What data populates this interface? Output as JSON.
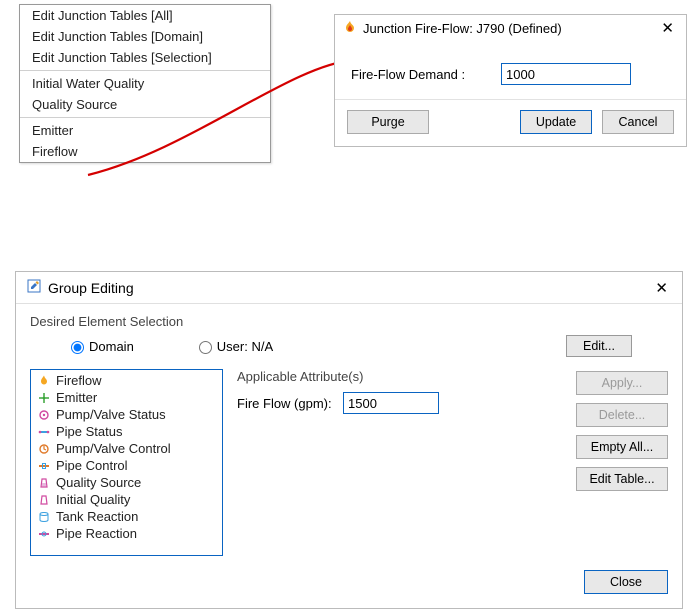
{
  "context_menu": {
    "items": [
      "Edit Junction Tables [All]",
      "Edit Junction Tables [Domain]",
      "Edit Junction Tables [Selection]",
      "---",
      "Initial Water Quality",
      "Quality Source",
      "---",
      "Emitter",
      "Fireflow"
    ]
  },
  "fireflow_dialog": {
    "title": "Junction Fire-Flow: J790 (Defined)",
    "field_label": "Fire-Flow Demand :",
    "field_value": "1000",
    "purge": "Purge",
    "update": "Update",
    "cancel": "Cancel"
  },
  "group_editing": {
    "title": "Group Editing",
    "desired_label": "Desired Element Selection",
    "domain_label": "Domain",
    "user_label": "User: N/A",
    "edit_btn": "Edit...",
    "list": [
      {
        "icon": "fire",
        "label": "Fireflow"
      },
      {
        "icon": "emitter",
        "label": "Emitter"
      },
      {
        "icon": "pump-status",
        "label": "Pump/Valve Status"
      },
      {
        "icon": "pipe-status",
        "label": "Pipe Status"
      },
      {
        "icon": "pump-control",
        "label": "Pump/Valve Control"
      },
      {
        "icon": "pipe-control",
        "label": "Pipe Control"
      },
      {
        "icon": "quality-source",
        "label": "Quality Source"
      },
      {
        "icon": "initial-quality",
        "label": "Initial Quality"
      },
      {
        "icon": "tank-reaction",
        "label": "Tank Reaction"
      },
      {
        "icon": "pipe-reaction",
        "label": "Pipe Reaction"
      }
    ],
    "attr_header": "Applicable Attribute(s)",
    "attr_label": "Fire Flow (gpm):",
    "attr_value": "1500",
    "buttons": {
      "apply": "Apply...",
      "delete": "Delete...",
      "empty": "Empty All...",
      "table": "Edit Table...",
      "close": "Close"
    }
  }
}
